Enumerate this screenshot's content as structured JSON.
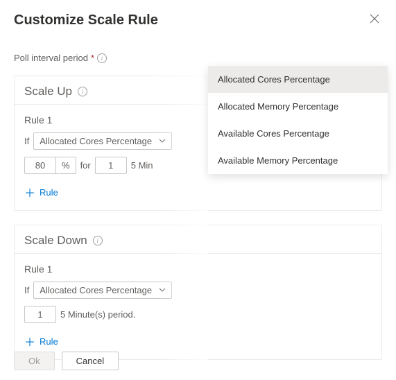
{
  "header": {
    "title": "Customize Scale Rule"
  },
  "poll": {
    "label": "Poll interval period",
    "required": "*"
  },
  "scaleUp": {
    "title": "Scale Up",
    "rule1": {
      "title": "Rule 1",
      "ifLabel": "If",
      "metric": "Allocated Cores Percentage",
      "threshold": "80",
      "unit": "%",
      "forLabel": "for",
      "duration": "1",
      "periodText": "5 Min"
    },
    "addRule": "Rule"
  },
  "scaleDown": {
    "title": "Scale Down",
    "rule1": {
      "title": "Rule 1",
      "ifLabel": "If",
      "metric": "Allocated Cores Percentage",
      "duration": "1",
      "periodText": "5 Minute(s) period."
    },
    "addRule": "Rule"
  },
  "footer": {
    "ok": "Ok",
    "cancel": "Cancel"
  },
  "dropdown": {
    "options": {
      "0": "Allocated Cores Percentage",
      "1": "Allocated Memory Percentage",
      "2": "Available Cores Percentage",
      "3": "Available Memory Percentage"
    }
  }
}
